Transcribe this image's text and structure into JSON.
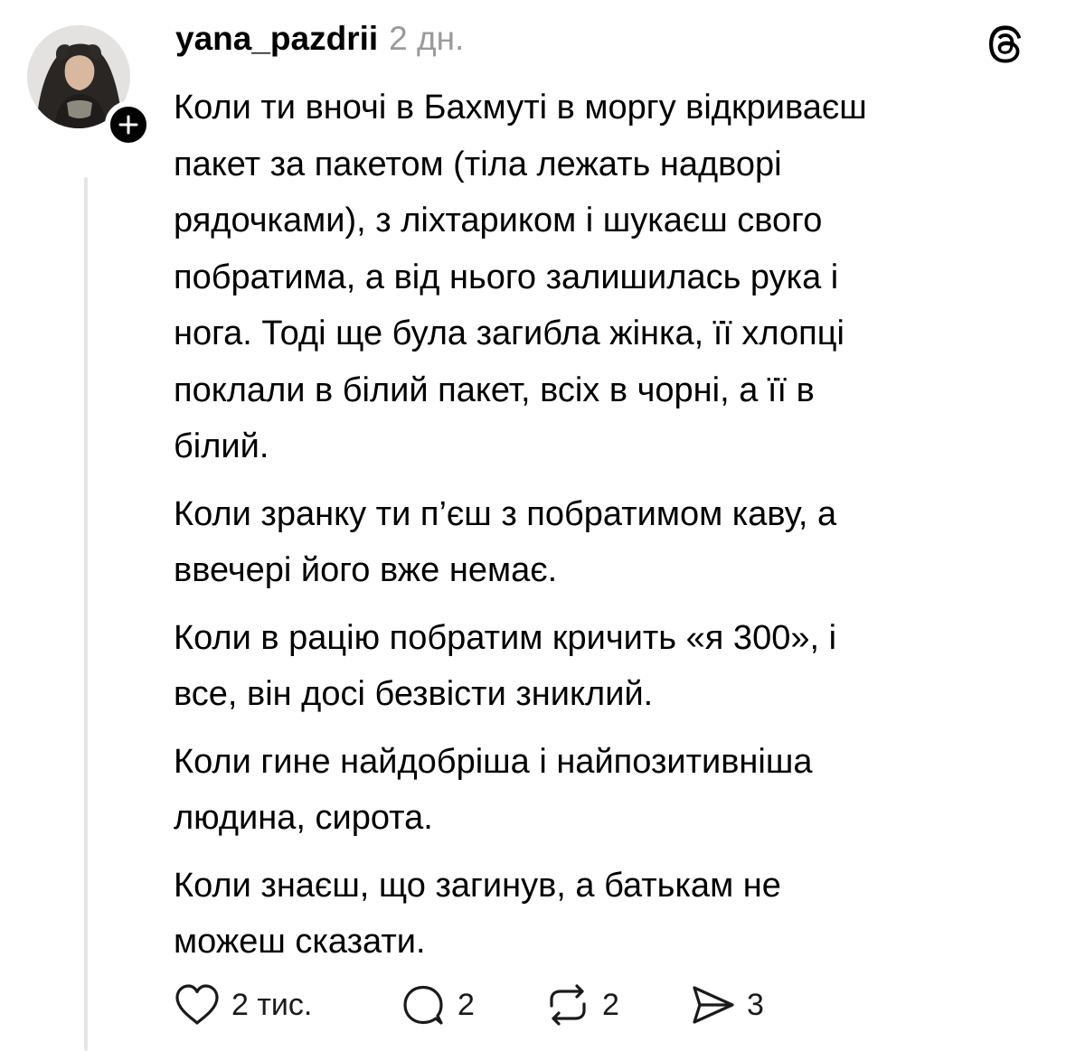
{
  "post": {
    "username": "yana_pazdrii",
    "timestamp": "2 дн.",
    "paragraphs": [
      "Коли ти вночі в Бахмуті в моргу відкриваєш\nпакет за пакетом (тіла лежать надворі\nрядочками), з ліхтариком і шукаєш свого\nпобратима, а від нього залишилась рука і\nнога. Тоді ще була загибла жінка, її хлопці\nпоклали в білий пакет, всіх в чорні, а її в\nбілий.",
      "Коли зранку ти п’єш з побратимом каву, а\nввечері його вже немає.",
      "Коли в рацію побратим кричить «я 300», і\nвсе, він досі безвісти зниклий.",
      "Коли гине найдобріша і найпозитивніша\nлюдина, сирота.",
      "Коли знаєш, що загинув, а батькам не\nможеш сказати."
    ]
  },
  "actions": {
    "likes": "2 тис.",
    "replies": "2",
    "reposts": "2",
    "shares": "3"
  },
  "icons": {
    "avatar": "profile-photo",
    "follow": "plus-icon",
    "logo": "threads-logo-icon",
    "like": "heart-icon",
    "reply": "speech-bubble-icon",
    "repost": "repost-arrows-icon",
    "share": "paper-plane-icon"
  },
  "colors": {
    "text": "#000000",
    "muted": "#9a9a9a",
    "thread_line": "#e6e6e6"
  }
}
